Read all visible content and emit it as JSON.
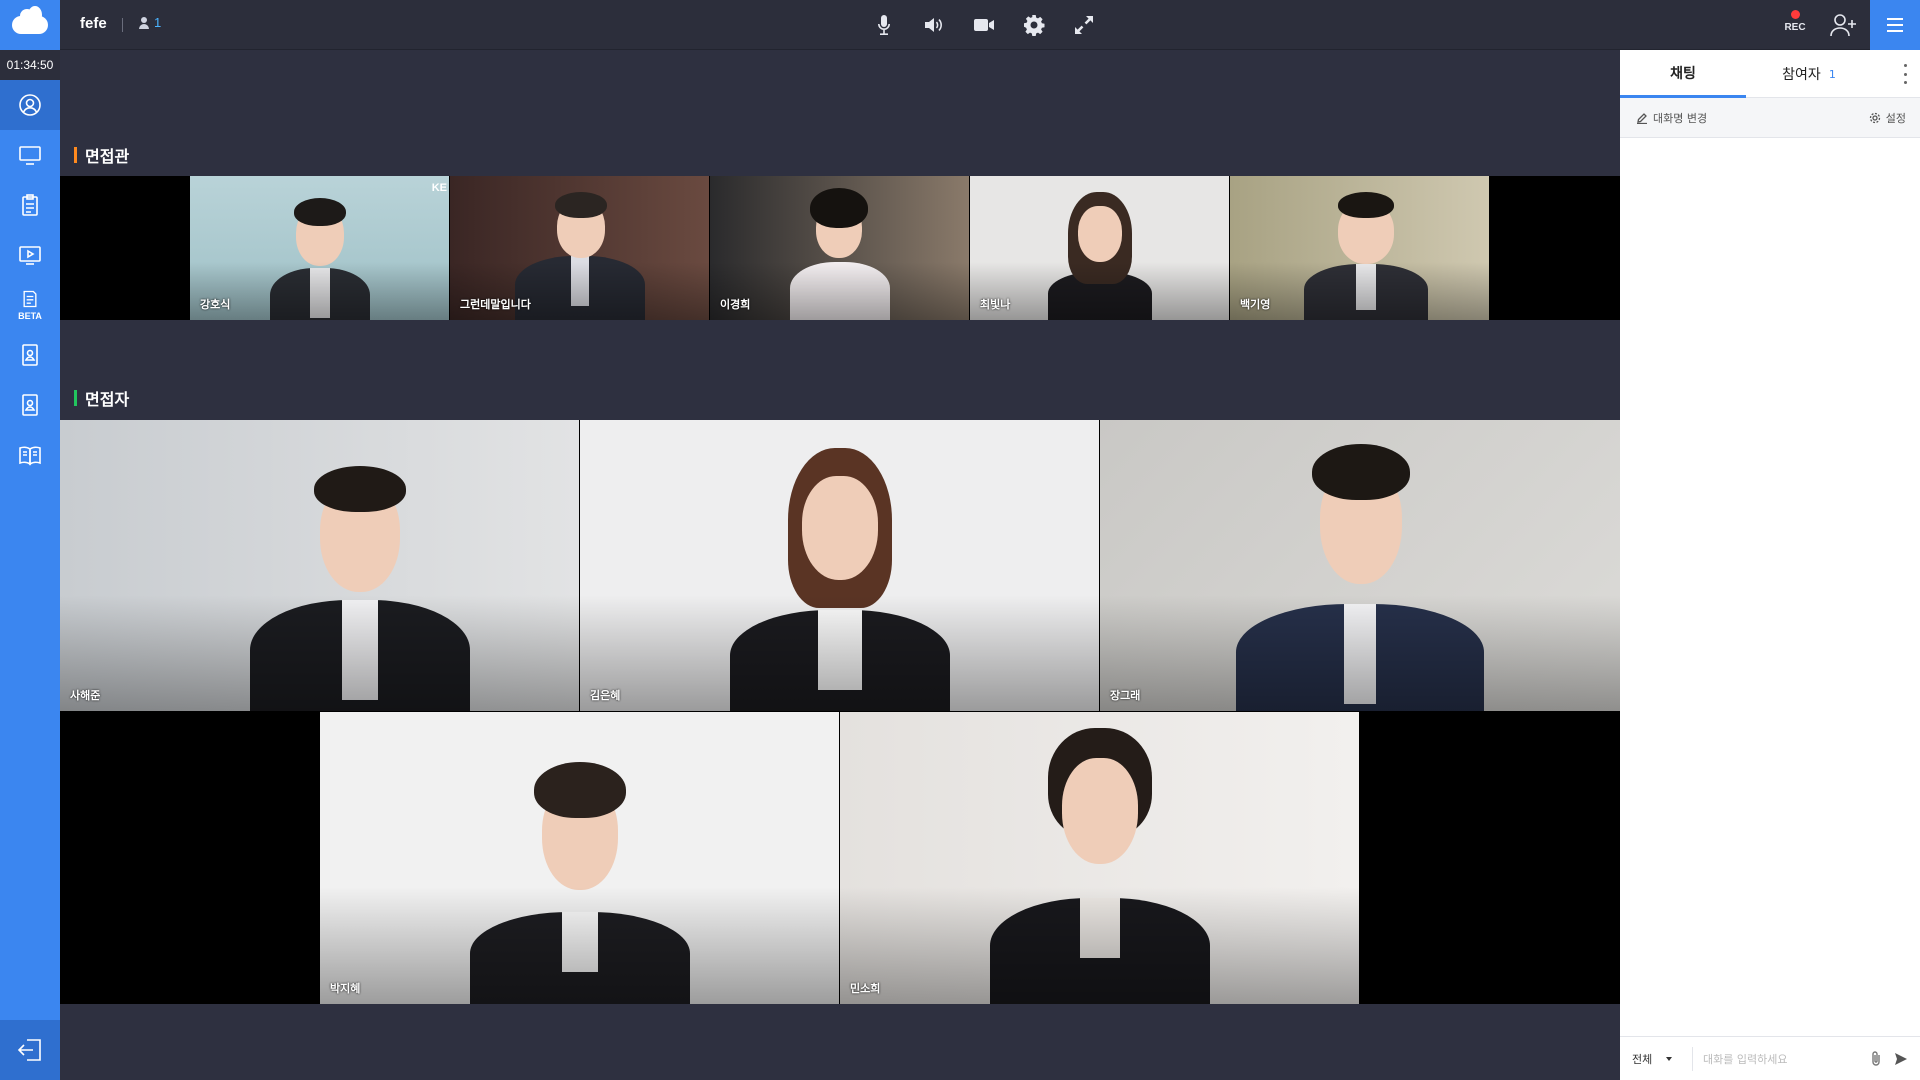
{
  "header": {
    "room_name": "fefe",
    "participant_count": "1",
    "rec_label": "REC",
    "controls": [
      "microphone-icon",
      "speaker-icon",
      "camera-icon",
      "gear-icon",
      "fullscreen-icon"
    ]
  },
  "sidebar": {
    "timer": "01:34:50",
    "items": [
      {
        "name": "profile-icon"
      },
      {
        "name": "screen-share-icon"
      },
      {
        "name": "clipboard-icon"
      },
      {
        "name": "video-play-icon"
      },
      {
        "name": "note-beta-icon",
        "badge": "BETA"
      },
      {
        "name": "id-card-icon"
      },
      {
        "name": "id-card-icon-2"
      },
      {
        "name": "book-icon"
      }
    ],
    "exit_icon": "exit-icon"
  },
  "interviewers": {
    "title": "면접관",
    "accent": "#ff8a1f",
    "people": [
      {
        "name": "강호식",
        "overlay": "KE"
      },
      {
        "name": "그런데말입니다"
      },
      {
        "name": "이경희"
      },
      {
        "name": "최빛나"
      },
      {
        "name": "백기영"
      }
    ]
  },
  "interviewees": {
    "title": "면접자",
    "accent": "#22c55e",
    "people": [
      {
        "name": "사해준"
      },
      {
        "name": "김은혜"
      },
      {
        "name": "장그래"
      },
      {
        "name": "박지혜"
      },
      {
        "name": "민소희"
      }
    ]
  },
  "panel": {
    "tabs": [
      {
        "label": "채팅",
        "active": true
      },
      {
        "label": "참여자",
        "count": "1",
        "active": false
      }
    ],
    "rename_label": "대화명 변경",
    "settings_label": "설정",
    "target_label": "전체",
    "input_placeholder": "대화를 입력하세요"
  },
  "colors": {
    "brand": "#3b86f0",
    "topbar": "#2c2e3b",
    "stage_bg": "#2e3040",
    "rec_dot": "#ff3b3b"
  }
}
